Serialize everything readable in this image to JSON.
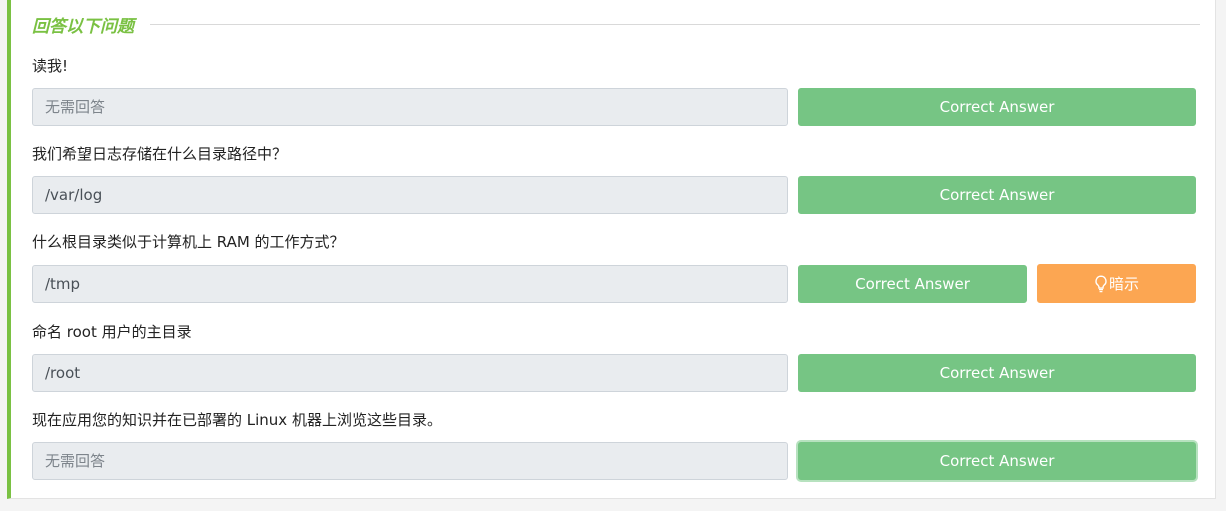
{
  "section": {
    "title": "回答以下问题"
  },
  "questions": [
    {
      "label": "读我!",
      "answer": "无需回答",
      "button": "Correct Answer"
    },
    {
      "label": "我们希望日志存储在什么目录路径中？",
      "answer": "/var/log",
      "button": "Correct Answer"
    },
    {
      "label": "什么根目录类似于计算机上 RAM 的工作方式？",
      "answer": "/tmp",
      "button": "Correct Answer",
      "hint": "暗示",
      "hint_icon": "lightbulb-icon"
    },
    {
      "label": "命名 root 用户的主目录",
      "answer": "/root",
      "button": "Correct Answer"
    },
    {
      "label": "现在应用您的知识并在已部署的 Linux 机器上浏览这些目录。",
      "answer": "无需回答",
      "button": "Correct Answer"
    }
  ],
  "colors": {
    "accent": "#7ac143",
    "correct_button": "#76c584",
    "hint_button": "#fca652",
    "answer_field": "#e9ecef"
  }
}
